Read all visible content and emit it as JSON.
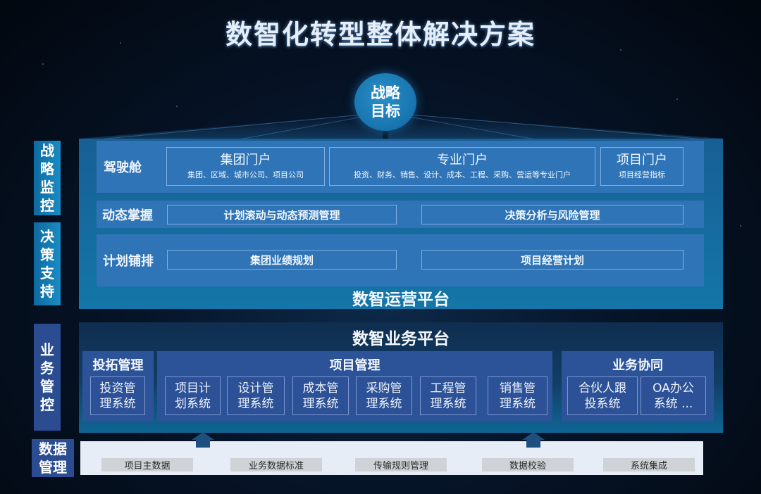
{
  "title": "数智化转型整体解决方案",
  "goal": {
    "line1": "战略",
    "line2": "目标"
  },
  "side_labels": [
    {
      "text": [
        "战",
        "略",
        "监",
        "控"
      ]
    },
    {
      "text": [
        "决",
        "策",
        "支",
        "持"
      ]
    },
    {
      "text": [
        "业",
        "务",
        "管",
        "控"
      ]
    },
    {
      "text": [
        "数据",
        "管理"
      ]
    }
  ],
  "ops_platform": {
    "title": "数智运营平台",
    "cockpit": {
      "label": "驾驶舱",
      "portals": [
        {
          "name": "集团门户",
          "desc": "集团、区域、城市公司、项目公司"
        },
        {
          "name": "专业门户",
          "desc": "投资、财务、销售、设计、成本、工程、采购、营运等专业门户"
        },
        {
          "name": "项目门户",
          "desc": "项目经营指标"
        }
      ]
    },
    "dynamic": {
      "label": "动态掌握",
      "items": [
        "计划滚动与动态预测管理",
        "决策分析与风险管理"
      ]
    },
    "planning": {
      "label": "计划铺排",
      "items": [
        "集团业绩规划",
        "项目经营计划"
      ]
    }
  },
  "biz_platform": {
    "title": "数智业务平台",
    "groups": [
      {
        "title": "投拓管理",
        "systems": [
          [
            "投资管",
            "理系统"
          ]
        ]
      },
      {
        "title": "项目管理",
        "systems": [
          [
            "项目计",
            "划系统"
          ],
          [
            "设计管",
            "理系统"
          ],
          [
            "成本管",
            "理系统"
          ],
          [
            "采购管",
            "理系统"
          ],
          [
            "工程管",
            "理系统"
          ],
          [
            "销售管",
            "理系统"
          ]
        ]
      },
      {
        "title": "业务协同",
        "systems": [
          [
            "合伙人跟",
            "投系统"
          ],
          [
            "OA办公",
            "系统 ..."
          ]
        ]
      }
    ]
  },
  "data_mgmt": {
    "items": [
      "项目主数据",
      "业务数据标准",
      "传输规则管理",
      "数据校验",
      "系统集成"
    ]
  },
  "colors": {
    "ops_row": "#2f74b6",
    "biz_group": "#2c5398",
    "side_cyan": "#1a8bc4",
    "side_navy": "#2b4c91",
    "goal_circle": "#1773ad",
    "data_bar": "#e6edf6",
    "arrow": "#1f4f7e"
  }
}
